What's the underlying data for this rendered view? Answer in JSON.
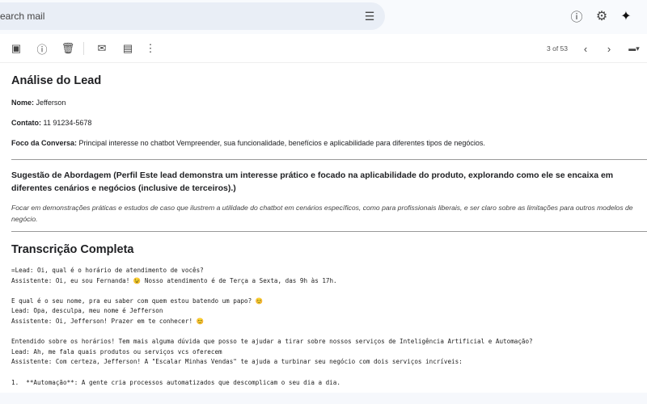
{
  "search": {
    "placeholder": "Search mail",
    "value": "earch mail"
  },
  "header_icons": [
    "help-icon",
    "settings-icon",
    "gemini-sparkle-icon"
  ],
  "toolbar": {
    "icons": [
      "archive-icon",
      "report-spam-icon",
      "delete-icon",
      "mark-unread-icon",
      "move-to-icon",
      "more-icon"
    ],
    "pagination": "3 of 53"
  },
  "email": {
    "title": "Análise do Lead",
    "nome_label": "Nome:",
    "nome": "Jefferson",
    "contato_label": "Contato:",
    "contato": "11 91234-5678",
    "foco_label": "Foco da Conversa:",
    "foco": "Principal interesse no chatbot Vempreender, sua funcionalidade, benefícios e aplicabilidade para diferentes tipos de negócios.",
    "sugestao": "Sugestão de Abordagem (Perfil Este lead demonstra um interesse prático e focado na aplicabilidade do produto, explorando como ele se encaixa em diferentes cenários e negócios (inclusive de terceiros).)",
    "sugestao_text": "Focar em demonstrações práticas e estudos de caso que ilustrem a utilidade do chatbot em cenários específicos, como para profissionais liberais, e ser claro sobre as limitações para outros modelos de negócio.",
    "transcricao_title": "Transcrição Completa",
    "transcript": "=Lead: Oi, qual é o horário de atendimento de vocês?\nAssistente: Oi, eu sou Fernanda! 😉 Nosso atendimento é de Terça a Sexta, das 9h às 17h.\n\nE qual é o seu nome, pra eu saber com quem estou batendo um papo? 😊\nLead: Opa, desculpa, meu nome é Jefferson\nAssistente: Oi, Jefferson! Prazer em te conhecer! 😊\n\nEntendido sobre os horários! Tem mais alguma dúvida que posso te ajudar a tirar sobre nossos serviços de Inteligência Artificial e Automação?\nLead: Ah, me fala quais produtos ou serviços vcs oferecem\nAssistente: Com certeza, Jefferson! A \"Escalar Minhas Vendas\" te ajuda a turbinar seu negócio com dois serviços incríveis:\n\n1.  **Automação**: A gente cria processos automatizados que descomplicam o seu dia a dia."
  }
}
